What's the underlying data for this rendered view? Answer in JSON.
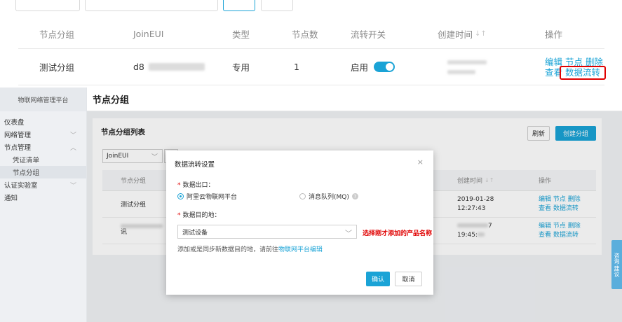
{
  "top_table": {
    "headers": {
      "group": "节点分组",
      "joineui": "JoinEUI",
      "type": "类型",
      "nodes": "节点数",
      "switch": "流转开关",
      "created": "创建时间",
      "ops": "操作"
    },
    "row": {
      "group": "测试分组",
      "joineui_prefix": "d8",
      "type": "专用",
      "nodes": "1",
      "switch_label": "启用",
      "ops": {
        "edit": "编辑",
        "node": "节点",
        "delete": "删除",
        "view": "查看",
        "flow": "数据流转"
      }
    }
  },
  "sidebar": {
    "brand": "物联网络管理平台",
    "items": [
      {
        "label": "仪表盘"
      },
      {
        "label": "网络管理"
      },
      {
        "label": "节点管理"
      },
      {
        "label": "凭证清单"
      },
      {
        "label": "节点分组"
      },
      {
        "label": "认证实验室"
      },
      {
        "label": "通知"
      }
    ]
  },
  "header": {
    "title": "节点分组"
  },
  "panel": {
    "title": "节点分组列表",
    "refresh": "刷新",
    "create": "创建分组",
    "filter": "JoinEUI",
    "headers": {
      "group": "节点分组",
      "created": "创建时间",
      "ops": "操作"
    },
    "rows": [
      {
        "group": "测试分组",
        "date": "2019-01-28",
        "time": "12:27:43",
        "ops1": "编辑 节点 删除",
        "ops2": "查看 数据流转"
      },
      {
        "group": "讯",
        "date_suffix": "7",
        "time_prefix": "19:45:",
        "ops1": "编辑 节点 删除",
        "ops2": "查看 数据流转"
      }
    ]
  },
  "feedback": "咨询·建议",
  "modal": {
    "title": "数据流转设置",
    "close": "×",
    "out_label": "数据出口：",
    "opt1": "阿里云物联网平台",
    "opt2": "消息队列(MQ)",
    "dest_label": "数据目的地：",
    "dest_value": "测试设备",
    "annotation": "选择刚才添加的产品名称",
    "hint_text": "添加或是同步新数据目的地，请前往",
    "hint_link": "物联网平台编辑",
    "ok": "确认",
    "cancel": "取消"
  }
}
